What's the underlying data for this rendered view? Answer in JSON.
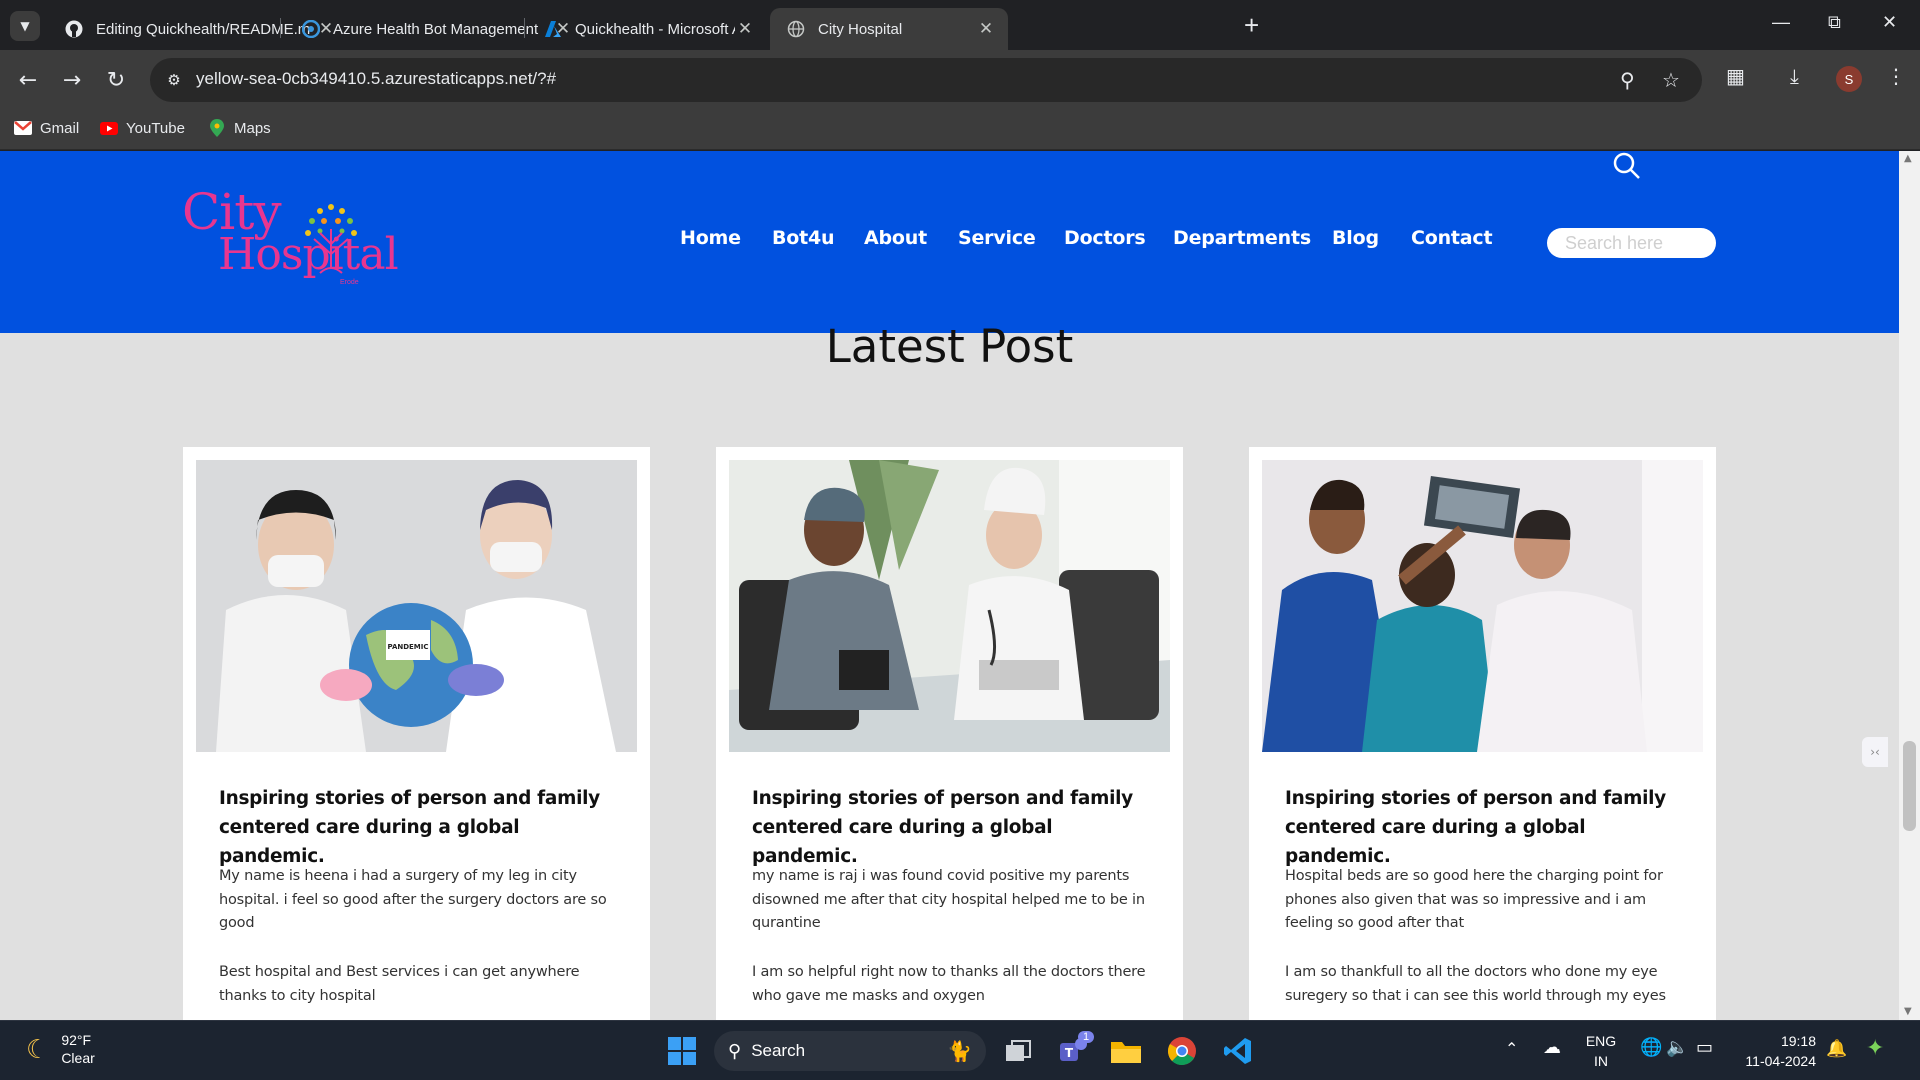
{
  "browser": {
    "tabs": [
      {
        "title": "Editing Quickhealth/README.m",
        "icon": "github-icon"
      },
      {
        "title": "Azure Health Bot Management",
        "icon": "health-bot-icon"
      },
      {
        "title": "Quickhealth - Microsoft Azure",
        "icon": "azure-icon"
      },
      {
        "title": "City Hospital",
        "icon": "globe-icon"
      }
    ],
    "url": "yellow-sea-0cb349410.5.azurestaticapps.net/?#",
    "profile_initial": "S",
    "bookmarks": [
      {
        "label": "Gmail"
      },
      {
        "label": "YouTube"
      },
      {
        "label": "Maps"
      }
    ]
  },
  "site": {
    "logo": {
      "line1": "City",
      "line2": "Hospital",
      "tagline": "Erode"
    },
    "nav": [
      "Home",
      "Bot4u",
      "About",
      "Service",
      "Doctors",
      "Departments",
      "Blog",
      "Contact"
    ],
    "search_placeholder": "Search here",
    "section_title": "Latest Post",
    "cards": [
      {
        "title": "Inspiring stories of person and family centered care during a global pandemic.",
        "p1": "My name is heena i had a surgery of my leg in city hospital. i feel so good after the surgery doctors are so good",
        "p2": "Best hospital and Best services i can get anywhere thanks to city hospital",
        "image_label": "PANDEMIC"
      },
      {
        "title": "Inspiring stories of person and family centered care during a global pandemic.",
        "p1": "my name is raj i was found covid positive my parents disowned me after that city hospital helped me to be in qurantine",
        "p2": "I am so helpful right now to thanks all the doctors there who gave me masks and oxygen"
      },
      {
        "title": "Inspiring stories of person and family centered care during a global pandemic.",
        "p1": "Hospital beds are so good here the charging point for phones also given that was so impressive and i am feeling so good after that",
        "p2": "I am so thankfull to all the doctors who done my eye suregery so that i can see this world through my eyes"
      }
    ]
  },
  "taskbar": {
    "weather_temp": "92°F",
    "weather_desc": "Clear",
    "search_label": "Search",
    "teams_badge": "1",
    "lang_line1": "ENG",
    "lang_line2": "IN",
    "time": "19:18",
    "date": "11-04-2024"
  },
  "colors": {
    "header_blue": "#0151df",
    "logo_pink": "#e8368f",
    "page_bg": "#e0e0e0"
  }
}
